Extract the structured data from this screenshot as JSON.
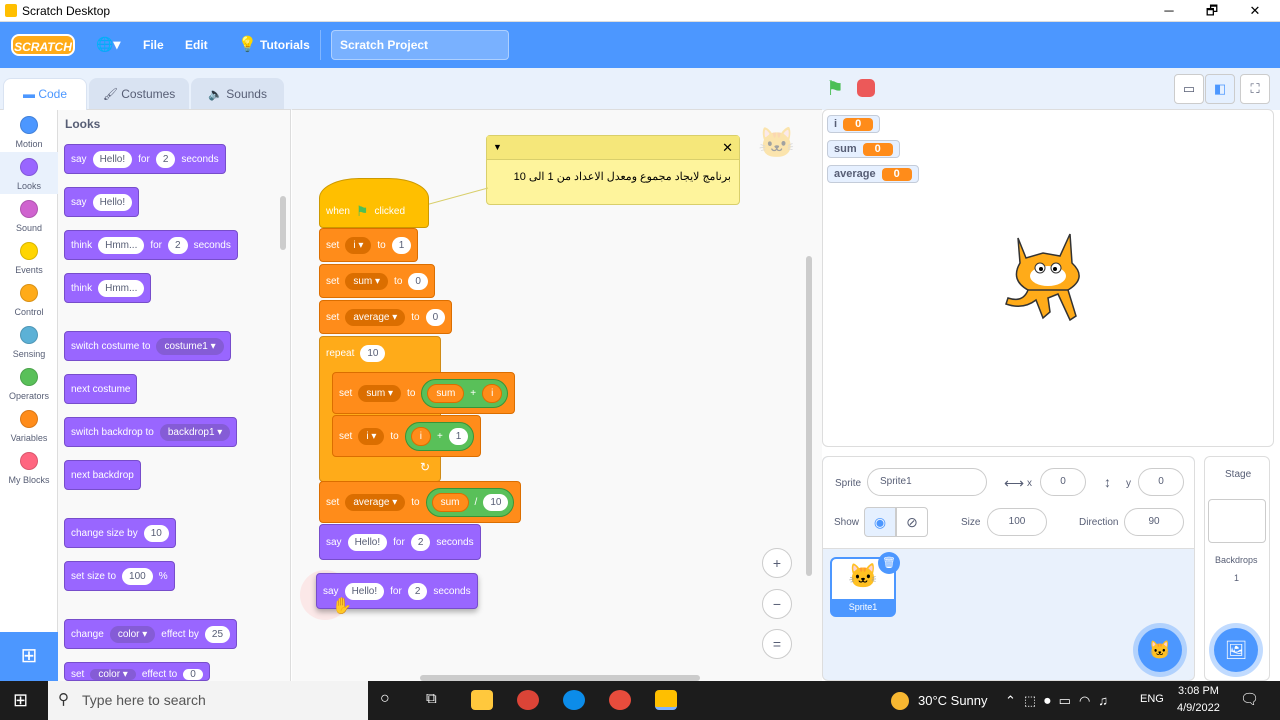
{
  "window": {
    "title": "Scratch Desktop",
    "min": "─",
    "max": "🗗",
    "close": "✕"
  },
  "menu": {
    "logo": "SCRATCH",
    "globe": "🌐▾",
    "file": "File",
    "edit": "Edit",
    "tutorials": "Tutorials",
    "project_title": "Scratch Project"
  },
  "tabs": {
    "code": "Code",
    "costumes": "Costumes",
    "sounds": "Sounds"
  },
  "categories": [
    {
      "label": "Motion",
      "color": "#4c97ff"
    },
    {
      "label": "Looks",
      "color": "#9966ff"
    },
    {
      "label": "Sound",
      "color": "#cf63cf"
    },
    {
      "label": "Events",
      "color": "#ffd500"
    },
    {
      "label": "Control",
      "color": "#ffab19"
    },
    {
      "label": "Sensing",
      "color": "#5cb1d6"
    },
    {
      "label": "Operators",
      "color": "#59c059"
    },
    {
      "label": "Variables",
      "color": "#ff8c1a"
    },
    {
      "label": "My Blocks",
      "color": "#ff6680"
    }
  ],
  "palette": {
    "heading": "Looks",
    "say_for": {
      "t1": "say",
      "v": "Hello!",
      "t2": "for",
      "n": "2",
      "t3": "seconds"
    },
    "say": {
      "t1": "say",
      "v": "Hello!"
    },
    "think_for": {
      "t1": "think",
      "v": "Hmm...",
      "t2": "for",
      "n": "2",
      "t3": "seconds"
    },
    "think": {
      "t1": "think",
      "v": "Hmm..."
    },
    "switch_costume": {
      "t1": "switch costume to",
      "v": "costume1 ▾"
    },
    "next_costume": "next costume",
    "switch_backdrop": {
      "t1": "switch backdrop to",
      "v": "backdrop1 ▾"
    },
    "next_backdrop": "next backdrop",
    "change_size": {
      "t1": "change size by",
      "v": "10"
    },
    "set_size": {
      "t1": "set size to",
      "v": "100",
      "t2": "%"
    },
    "change_effect": {
      "t1": "change",
      "v": "color ▾",
      "t2": "effect by",
      "n": "25"
    },
    "set_effect": {
      "t1": "set",
      "v": "color ▾",
      "t2": "effect to",
      "n": "0"
    }
  },
  "note": {
    "text": "برنامج لايجاد مجموع ومعدل الاعداد من 1 الى 10",
    "close": "✕",
    "collapse": "▼"
  },
  "script": {
    "hat": {
      "t1": "when",
      "t2": "clicked"
    },
    "set_i": {
      "t1": "set",
      "var": "i ▾",
      "t2": "to",
      "v": "1"
    },
    "set_sum": {
      "t1": "set",
      "var": "sum ▾",
      "t2": "to",
      "v": "0"
    },
    "set_avg": {
      "t1": "set",
      "var": "average ▾",
      "t2": "to",
      "v": "0"
    },
    "repeat": {
      "t1": "repeat",
      "v": "10"
    },
    "set_sum2": {
      "t1": "set",
      "var": "sum ▾",
      "t2": "to",
      "a": "sum",
      "op": "+",
      "b": "i"
    },
    "set_i2": {
      "t1": "set",
      "var": "i ▾",
      "t2": "to",
      "a": "i",
      "op": "+",
      "b": "1"
    },
    "set_avg2": {
      "t1": "set",
      "var": "average ▾",
      "t2": "to",
      "a": "sum",
      "op": "/",
      "b": "10"
    },
    "say1": {
      "t1": "say",
      "v": "Hello!",
      "t2": "for",
      "n": "2",
      "t3": "seconds"
    },
    "say2": {
      "t1": "say",
      "v": "Hello!",
      "t2": "for",
      "n": "2",
      "t3": "seconds"
    }
  },
  "zoom": {
    "in": "+",
    "out": "−",
    "reset": "="
  },
  "monitors": [
    {
      "name": "i",
      "value": "0"
    },
    {
      "name": "sum",
      "value": "0"
    },
    {
      "name": "average",
      "value": "0"
    }
  ],
  "sprite": {
    "label": "Sprite",
    "name": "Sprite1",
    "x_label": "x",
    "x": "0",
    "y_label": "y",
    "y": "0",
    "show_label": "Show",
    "size_label": "Size",
    "size": "100",
    "direction_label": "Direction",
    "direction": "90",
    "thumb_name": "Sprite1"
  },
  "stage_panel": {
    "title": "Stage",
    "backdrops_label": "Backdrops",
    "backdrops_count": "1"
  },
  "taskbar": {
    "search": "Type here to search",
    "weather": "30°C  Sunny",
    "lang": "ENG",
    "time": "3:08 PM",
    "date": "4/9/2022"
  }
}
